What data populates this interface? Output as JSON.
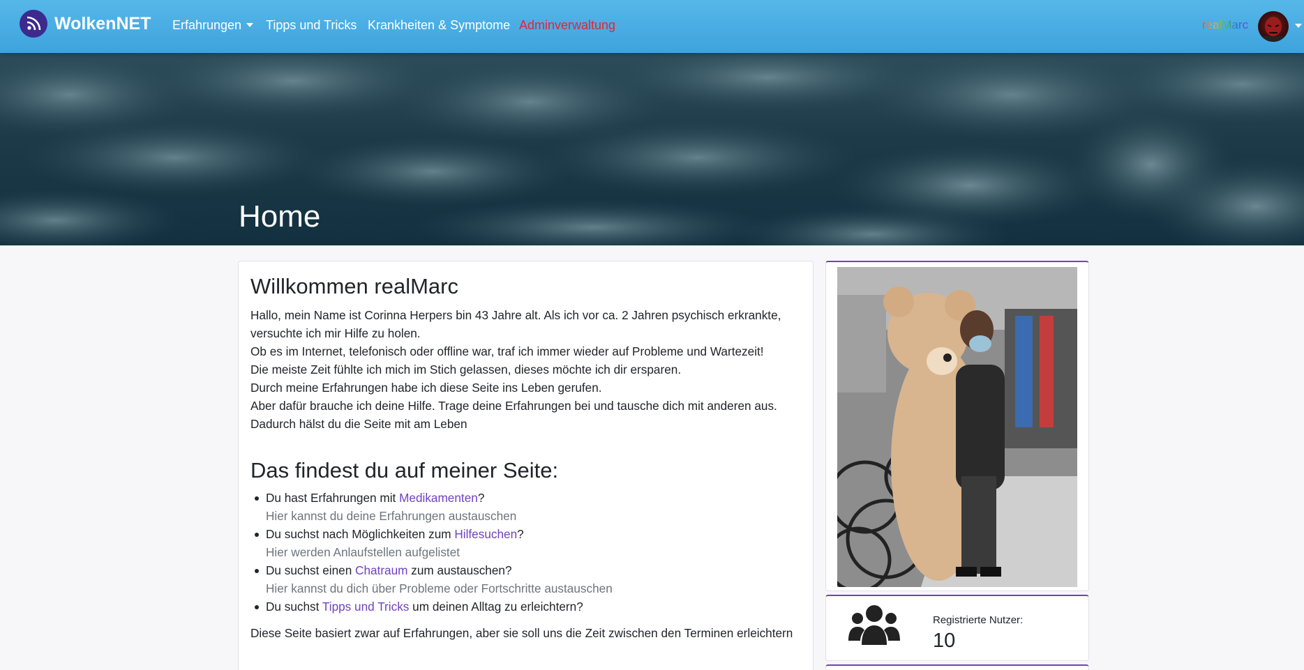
{
  "navbar": {
    "brand": "WolkenNET",
    "items": [
      {
        "label": "Erfahrungen",
        "has_dropdown": true
      },
      {
        "label": "Tipps und Tricks"
      },
      {
        "label": "Krankheiten & Symptome"
      },
      {
        "label": "Adminverwaltung",
        "color": "#e8242e"
      }
    ],
    "user": {
      "name": "realMarc"
    }
  },
  "hero": {
    "title": "Home"
  },
  "main": {
    "welcome": "Willkommen realMarc",
    "intro": [
      "Hallo, mein Name ist Corinna Herpers bin 43 Jahre alt. Als ich vor ca. 2 Jahren psychisch erkrankte, versuchte ich mir Hilfe zu holen.",
      "Ob es im Internet, telefonisch oder offline war, traf ich immer wieder auf Probleme und Wartezeit!",
      "Die meiste Zeit fühlte ich mich im Stich gelassen, dieses möchte ich dir ersparen.",
      "Durch meine Erfahrungen habe ich diese Seite ins Leben gerufen.",
      "Aber dafür brauche ich deine Hilfe. Trage deine Erfahrungen bei und tausche dich mit anderen aus.",
      "Dadurch hälst du die Seite mit am Leben"
    ],
    "features_title": "Das findest du auf meiner Seite:",
    "features": [
      {
        "before": "Du hast Erfahrungen mit ",
        "link": "Medikamenten",
        "after": "?",
        "sub": "Hier kannst du deine Erfahrungen austauschen"
      },
      {
        "before": "Du suchst nach Möglichkeiten zum ",
        "link": "Hilfesuchen",
        "after": "?",
        "sub": "Hier werden Anlaufstellen aufgelistet"
      },
      {
        "before": "Du suchst einen ",
        "link": "Chatraum",
        "after": " zum austauschen?",
        "sub": "Hier kannst du dich über Probleme oder Fortschritte austauschen"
      },
      {
        "before": "Du suchst ",
        "link": "Tipps und Tricks",
        "after": " um deinen Alltag zu erleichtern?",
        "sub": ""
      }
    ],
    "footer": "Diese Seite basiert zwar auf Erfahrungen, aber sie soll uns die Zeit zwischen den Terminen erleichtern"
  },
  "sidebar": {
    "users_label": "Registrierte Nutzer:",
    "users_count": "10"
  },
  "colors": {
    "accent": "#6f42c1",
    "nav": "#4aaee4",
    "admin": "#e8242e"
  }
}
